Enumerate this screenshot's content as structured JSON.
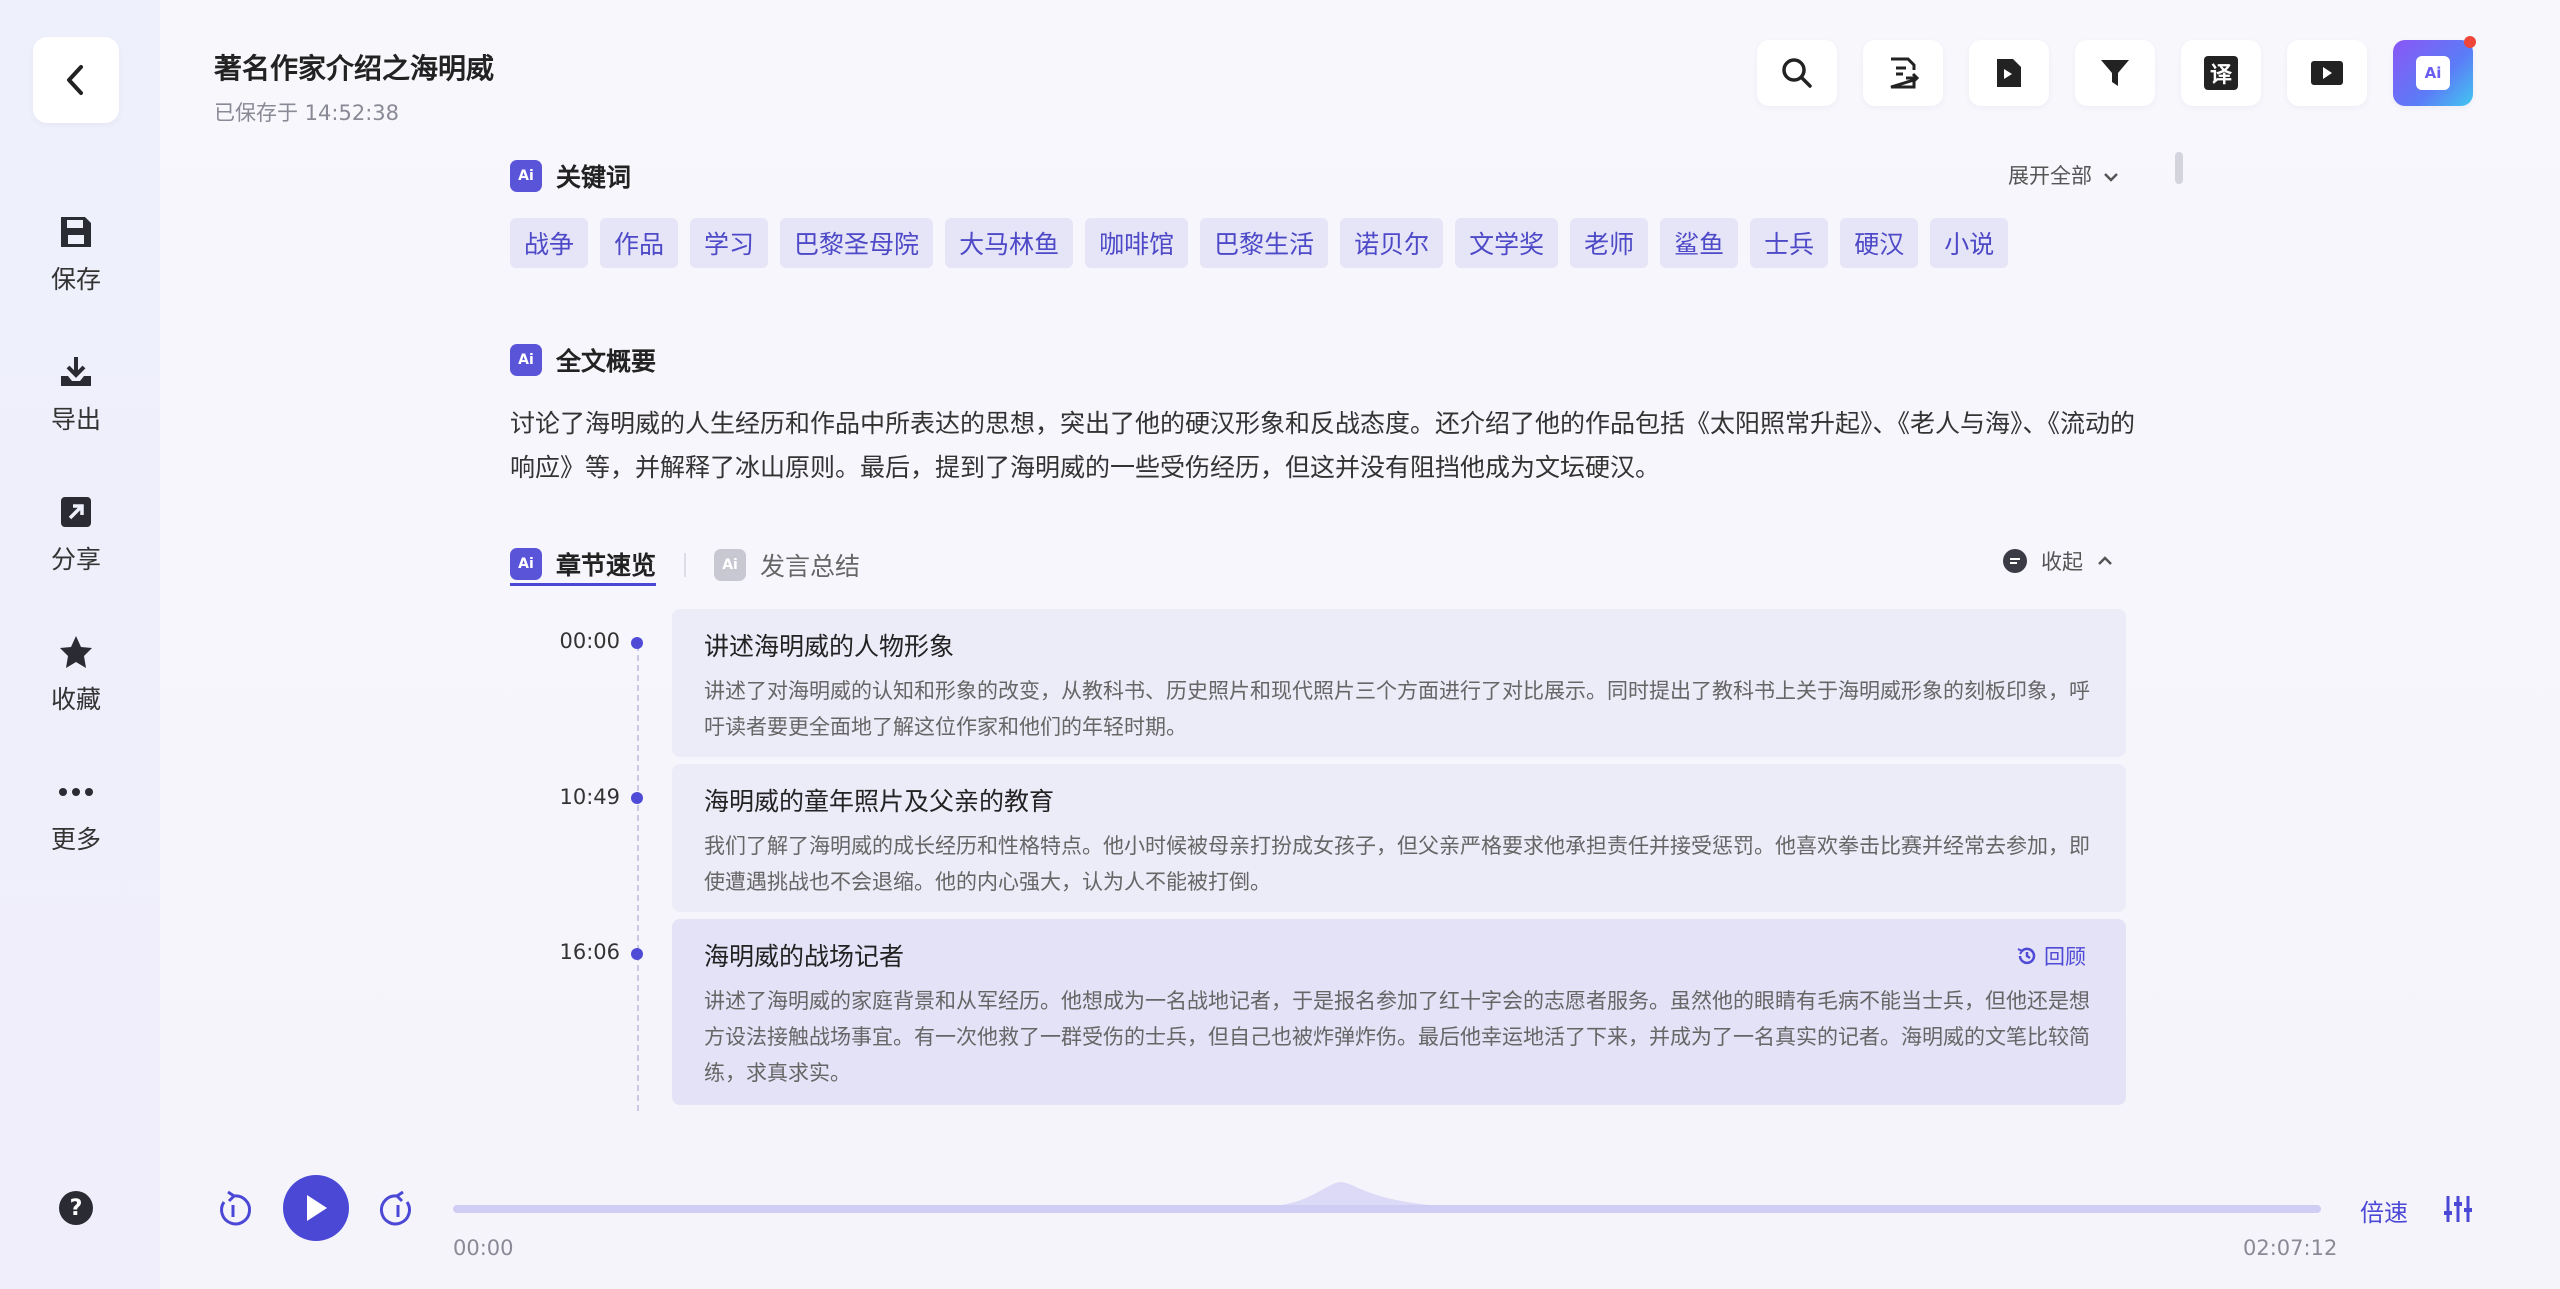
{
  "colors": {
    "accent": "#4b48d6",
    "tag_bg": "#e6e5f8",
    "tag_text": "#4d49c7"
  },
  "sidebar": {
    "items": [
      {
        "icon": "save-icon",
        "label": "保存"
      },
      {
        "icon": "export-icon",
        "label": "导出"
      },
      {
        "icon": "share-icon",
        "label": "分享"
      },
      {
        "icon": "star-icon",
        "label": "收藏"
      },
      {
        "icon": "more-icon",
        "label": "更多"
      }
    ],
    "help": "?"
  },
  "header": {
    "title": "著名作家介绍之海明威",
    "saved": "已保存于 14:52:38"
  },
  "toolbar": {
    "translate_glyph": "译",
    "ai_glyph": "Ai"
  },
  "keywords": {
    "badge": "Ai",
    "title": "关键词",
    "expand_label": "展开全部",
    "tags": [
      "战争",
      "作品",
      "学习",
      "巴黎圣母院",
      "大马林鱼",
      "咖啡馆",
      "巴黎生活",
      "诺贝尔",
      "文学奖",
      "老师",
      "鲨鱼",
      "士兵",
      "硬汉",
      "小说"
    ]
  },
  "summary": {
    "badge": "Ai",
    "title": "全文概要",
    "text": "讨论了海明威的人生经历和作品中所表达的思想，突出了他的硬汉形象和反战态度。还介绍了他的作品包括《太阳照常升起》、《老人与海》、《流动的响应》等，并解释了冰山原则。最后，提到了海明威的一些受伤经历，但这并没有阻挡他成为文坛硬汉。"
  },
  "chapter_tabs": {
    "badge": "Ai",
    "active": "章节速览",
    "inactive": "发言总结",
    "collapse_label": "收起"
  },
  "chapters": [
    {
      "time": "00:00",
      "title": "讲述海明威的人物形象",
      "desc": "讲述了对海明威的认知和形象的改变，从教科书、历史照片和现代照片三个方面进行了对比展示。同时提出了教科书上关于海明威形象的刻板印象，呼吁读者要更全面地了解这位作家和他们的年轻时期。"
    },
    {
      "time": "10:49",
      "title": "海明威的童年照片及父亲的教育",
      "desc": "我们了解了海明威的成长经历和性格特点。他小时候被母亲打扮成女孩子，但父亲严格要求他承担责任并接受惩罚。他喜欢拳击比赛并经常去参加，即使遭遇挑战也不会退缩。他的内心强大，认为人不能被打倒。"
    },
    {
      "time": "16:06",
      "title": "海明威的战场记者",
      "desc": "讲述了海明威的家庭背景和从军经历。他想成为一名战地记者，于是报名参加了红十字会的志愿者服务。虽然他的眼睛有毛病不能当士兵，但他还是想方设法接触战场事宜。有一次他救了一群受伤的士兵，但自己也被炸弹炸伤。最后他幸运地活了下来，并成为了一名真实的记者。海明威的文笔比较简练，求真求实。",
      "review": "回顾"
    }
  ],
  "player": {
    "current": "00:00",
    "total": "02:07:12",
    "progress": 0,
    "speed_label": "倍速"
  }
}
